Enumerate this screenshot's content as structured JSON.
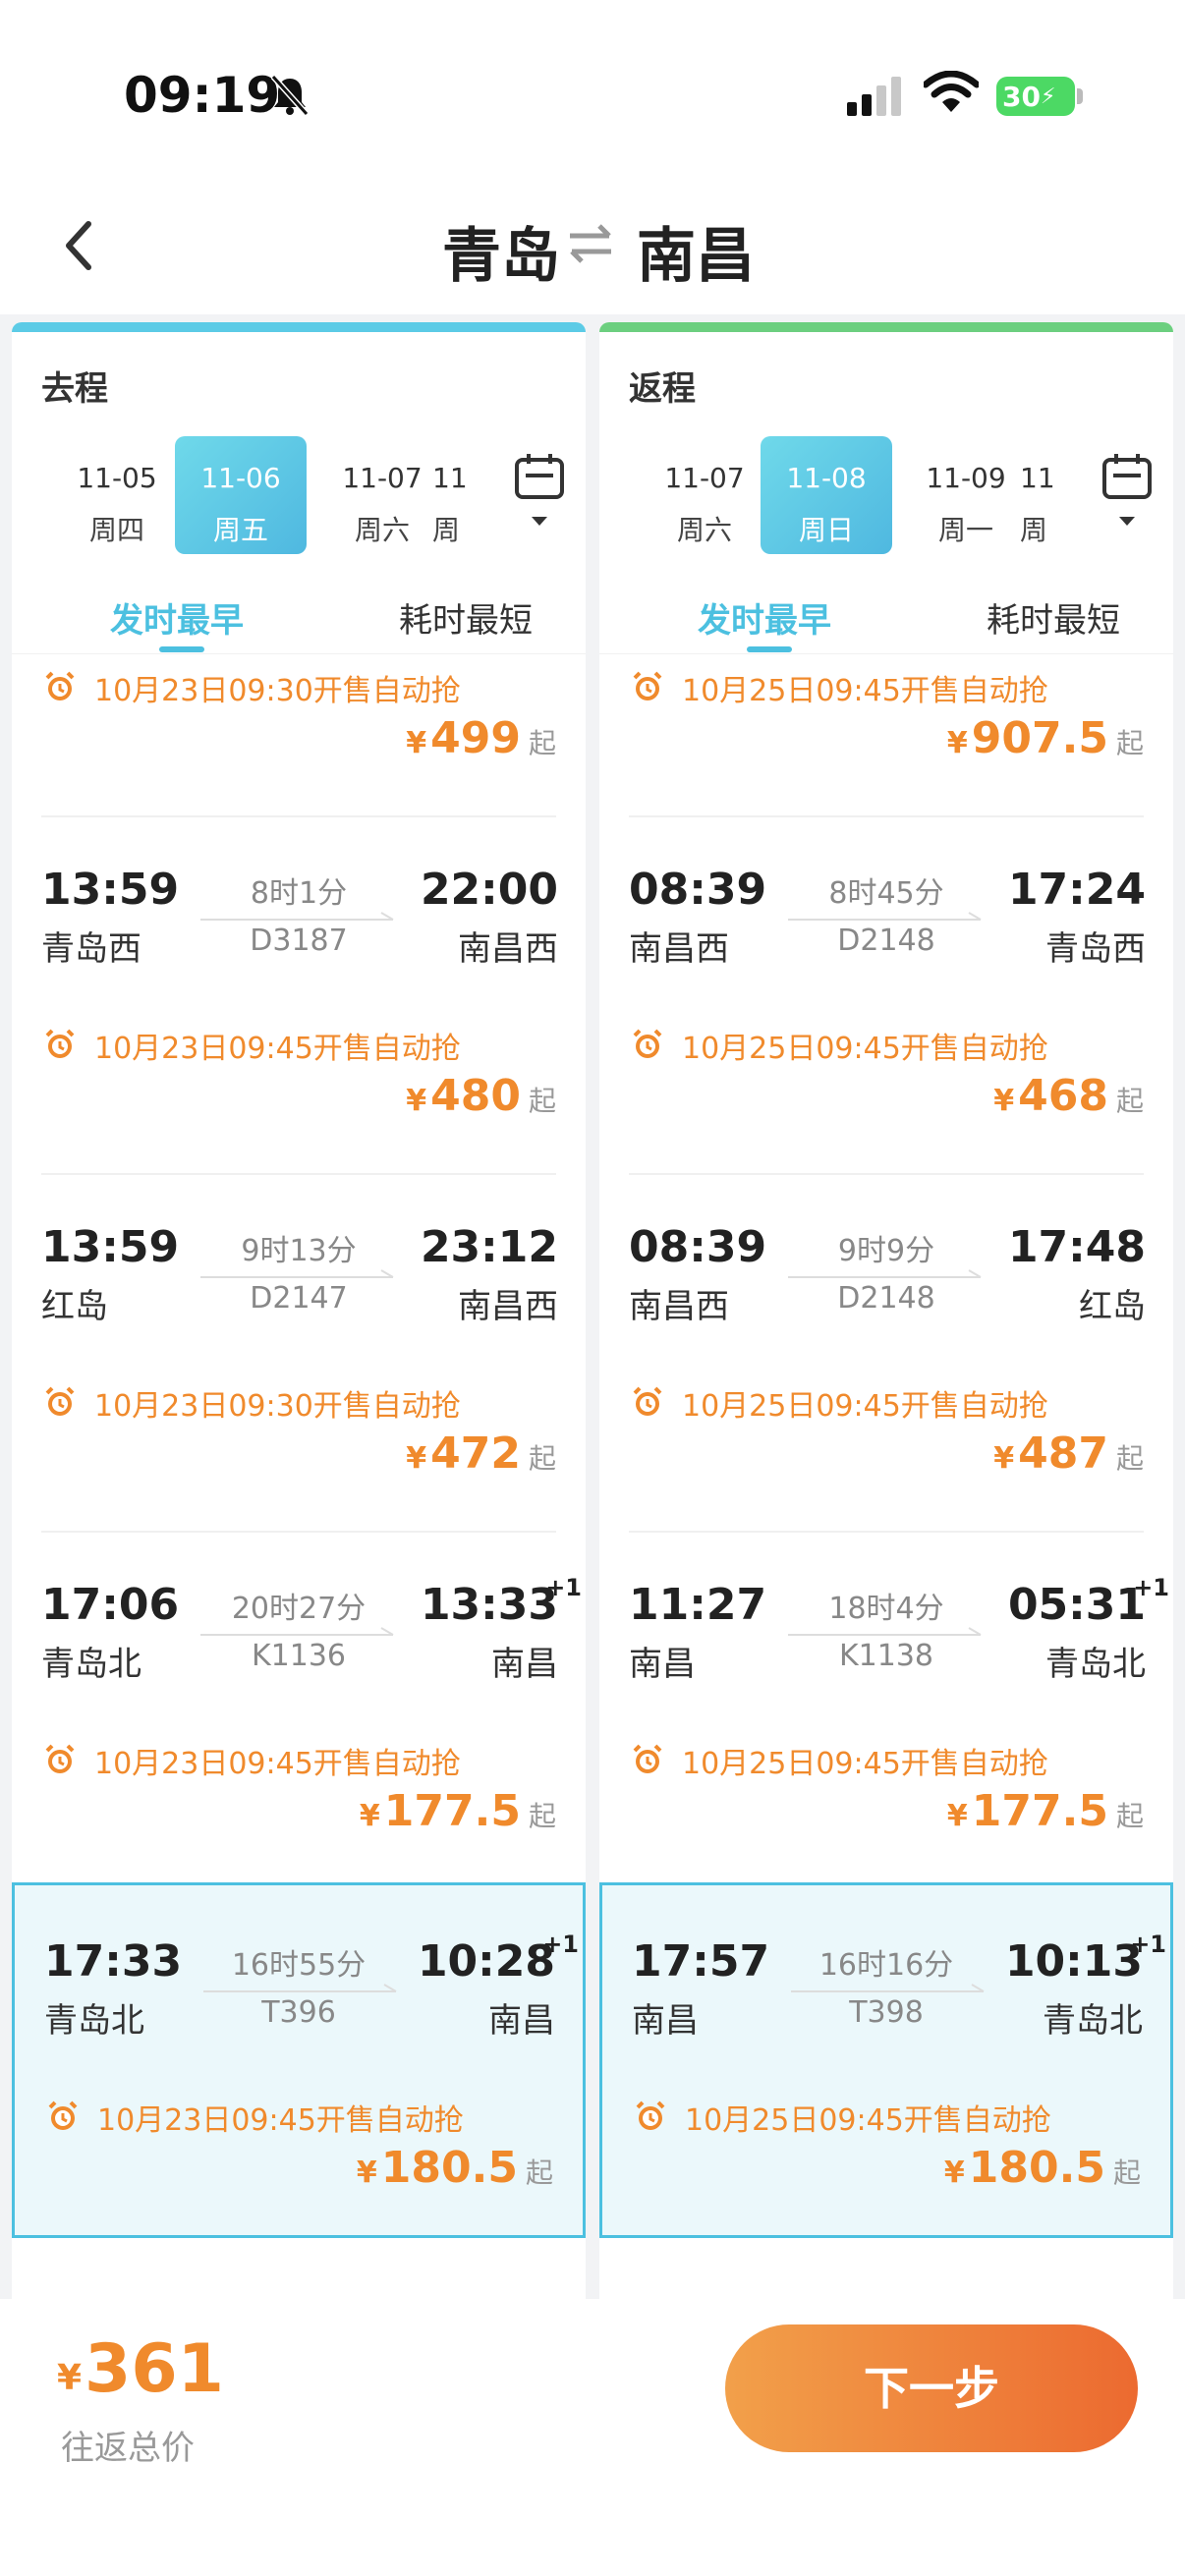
{
  "status": {
    "time": "09:19",
    "battery": "30"
  },
  "header": {
    "from": "青岛",
    "to": "南昌"
  },
  "outbound": {
    "label": "去程",
    "dates": [
      {
        "date": "11-05",
        "weekday": "周四"
      },
      {
        "date": "11-06",
        "weekday": "周五"
      },
      {
        "date": "11-07",
        "weekday": "周六"
      },
      {
        "date": "11",
        "weekday": "周"
      }
    ],
    "sort_tabs": [
      "发时最早",
      "耗时最短"
    ],
    "top_sale": "10月23日09:30开售自动抢",
    "top_price": "499",
    "trains": [
      {
        "dep_time": "13:59",
        "dep_station": "青岛西",
        "duration": "8时1分",
        "train_no": "D3187",
        "arr_time": "22:00",
        "arr_station": "南昌西",
        "next_day": "",
        "sale": "10月23日09:45开售自动抢",
        "price": "480"
      },
      {
        "dep_time": "13:59",
        "dep_station": "红岛",
        "duration": "9时13分",
        "train_no": "D2147",
        "arr_time": "23:12",
        "arr_station": "南昌西",
        "next_day": "",
        "sale": "10月23日09:30开售自动抢",
        "price": "472"
      },
      {
        "dep_time": "17:06",
        "dep_station": "青岛北",
        "duration": "20时27分",
        "train_no": "K1136",
        "arr_time": "13:33",
        "arr_station": "南昌",
        "next_day": "+1",
        "sale": "10月23日09:45开售自动抢",
        "price": "177.5"
      },
      {
        "dep_time": "17:33",
        "dep_station": "青岛北",
        "duration": "16时55分",
        "train_no": "T396",
        "arr_time": "10:28",
        "arr_station": "南昌",
        "next_day": "+1",
        "sale": "10月23日09:45开售自动抢",
        "price": "180.5"
      }
    ]
  },
  "return": {
    "label": "返程",
    "dates": [
      {
        "date": "11-07",
        "weekday": "周六"
      },
      {
        "date": "11-08",
        "weekday": "周日"
      },
      {
        "date": "11-09",
        "weekday": "周一"
      },
      {
        "date": "11",
        "weekday": "周"
      }
    ],
    "sort_tabs": [
      "发时最早",
      "耗时最短"
    ],
    "top_sale": "10月25日09:45开售自动抢",
    "top_price": "907.5",
    "trains": [
      {
        "dep_time": "08:39",
        "dep_station": "南昌西",
        "duration": "8时45分",
        "train_no": "D2148",
        "arr_time": "17:24",
        "arr_station": "青岛西",
        "next_day": "",
        "sale": "10月25日09:45开售自动抢",
        "price": "468"
      },
      {
        "dep_time": "08:39",
        "dep_station": "南昌西",
        "duration": "9时9分",
        "train_no": "D2148",
        "arr_time": "17:48",
        "arr_station": "红岛",
        "next_day": "",
        "sale": "10月25日09:45开售自动抢",
        "price": "487"
      },
      {
        "dep_time": "11:27",
        "dep_station": "南昌",
        "duration": "18时4分",
        "train_no": "K1138",
        "arr_time": "05:31",
        "arr_station": "青岛北",
        "next_day": "+1",
        "sale": "10月25日09:45开售自动抢",
        "price": "177.5"
      },
      {
        "dep_time": "17:57",
        "dep_station": "南昌",
        "duration": "16时16分",
        "train_no": "T398",
        "arr_time": "10:13",
        "arr_station": "青岛北",
        "next_day": "+1",
        "sale": "10月25日09:45开售自动抢",
        "price": "180.5"
      }
    ]
  },
  "common": {
    "yen": "¥",
    "qi": "起"
  },
  "footer": {
    "total_yen": "¥",
    "total": "361",
    "total_label": "往返总价",
    "next_label": "下一步"
  },
  "colors": {
    "accent": "#4cc0e0",
    "price": "#f08a2c",
    "return_strip": "#6ccf7f"
  }
}
